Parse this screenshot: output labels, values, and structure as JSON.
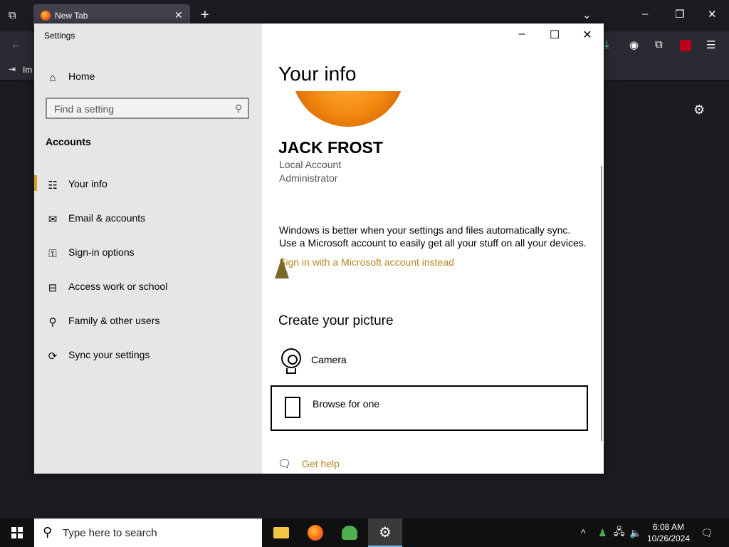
{
  "browser": {
    "tab_title": "New Tab",
    "bookmark_label": "Im",
    "new_tab_symbol": "+",
    "close_tab_symbol": "✕"
  },
  "settings": {
    "window_title": "Settings",
    "home_label": "Home",
    "search_placeholder": "Find a setting",
    "section_heading": "Accounts",
    "nav_items": [
      {
        "label": "Your info",
        "icon": "person-card-icon"
      },
      {
        "label": "Email & accounts",
        "icon": "mail-icon"
      },
      {
        "label": "Sign-in options",
        "icon": "key-icon"
      },
      {
        "label": "Access work or school",
        "icon": "briefcase-icon"
      },
      {
        "label": "Family & other users",
        "icon": "add-person-icon"
      },
      {
        "label": "Sync your settings",
        "icon": "sync-icon"
      }
    ],
    "selected_item": "Your info",
    "accent_color": "#d59b2f"
  },
  "main": {
    "title": "Your info",
    "user_name": "JACK FROST",
    "account_type": "Local Account",
    "role": "Administrator",
    "sync_line1": "Windows is better when your settings and files automatically sync.",
    "sync_line2": "Use a Microsoft account to easily get all your stuff on all your devices.",
    "ms_link": "Sign in with a Microsoft account instead",
    "create_picture_heading": "Create your picture",
    "camera_label": "Camera",
    "browse_label": "Browse for one",
    "help_link": "Get help",
    "link_color": "#b8861f"
  },
  "taskbar": {
    "search_placeholder": "Type here to search",
    "time": "6:08 AM",
    "date": "10/26/2024"
  }
}
